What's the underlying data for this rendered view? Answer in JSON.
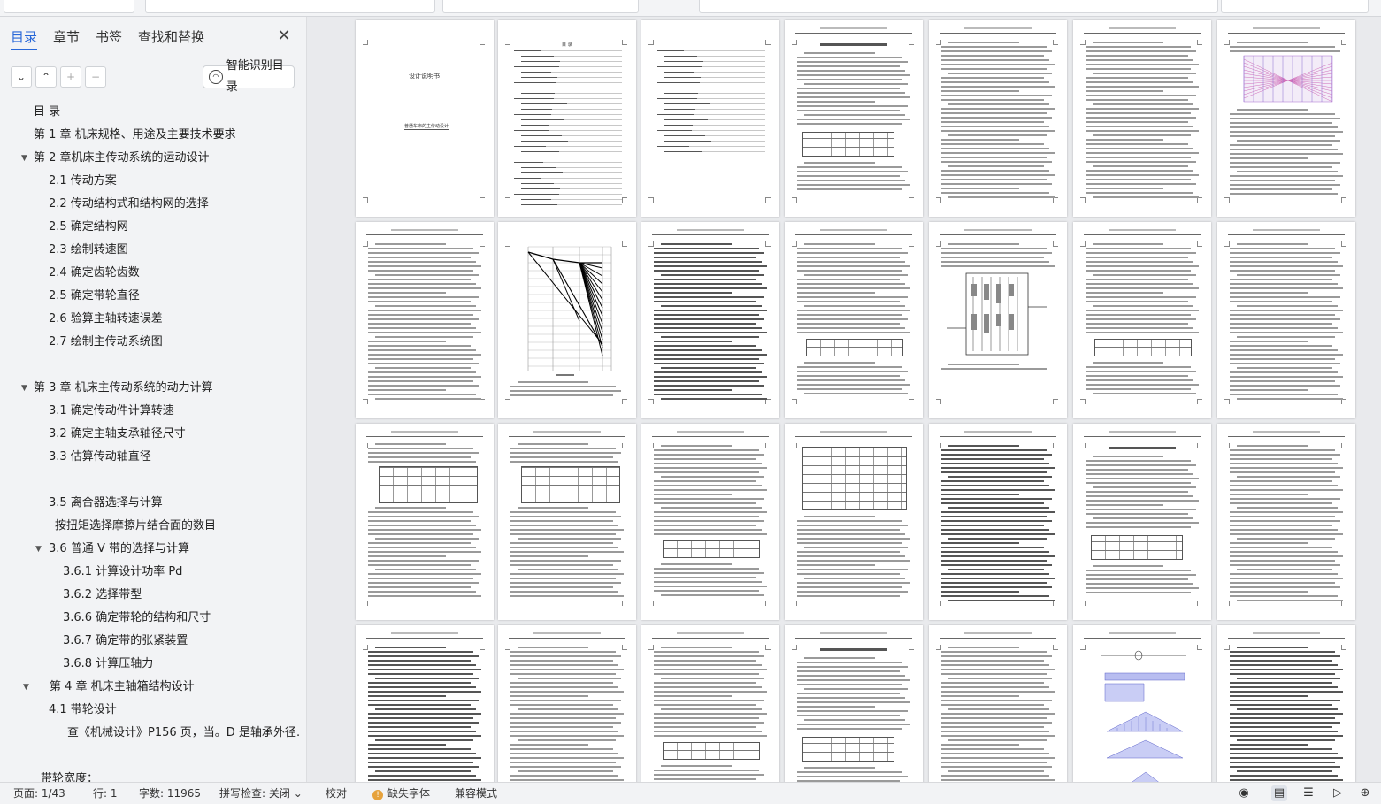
{
  "panel": {
    "tabs": [
      "目录",
      "章节",
      "书签",
      "查找和替换"
    ],
    "close_icon": "close-icon",
    "tools": {
      "collapse": "chevron-down-icon",
      "expand": "chevron-up-icon",
      "add": "plus-icon",
      "remove": "minus-icon"
    },
    "smart_toc_label": "智能识别目录"
  },
  "toc": [
    {
      "text": "目  录",
      "level": 1,
      "arrow": ""
    },
    {
      "text": "第 1 章  机床规格、用途及主要技术要求",
      "level": 1,
      "arrow": ""
    },
    {
      "text": "第 2 章机床主传动系统的运动设计",
      "level": 1,
      "arrow": "▼"
    },
    {
      "text": "2.1  传动方案",
      "level": 2,
      "arrow": ""
    },
    {
      "text": "2.2 传动结构式和结构网的选择",
      "level": 2,
      "arrow": ""
    },
    {
      "text": "2.5 确定结构网",
      "level": 2,
      "arrow": ""
    },
    {
      "text": "2.3 绘制转速图",
      "level": 2,
      "arrow": ""
    },
    {
      "text": "2.4  确定齿轮齿数",
      "level": 2,
      "arrow": ""
    },
    {
      "text": "2.5  确定带轮直径",
      "level": 2,
      "arrow": ""
    },
    {
      "text": "2.6  验算主轴转速误差",
      "level": 2,
      "arrow": ""
    },
    {
      "text": "2.7  绘制主传动系统图",
      "level": 2,
      "arrow": ""
    },
    {
      "text": "",
      "level": 2,
      "arrow": ""
    },
    {
      "text": "第 3 章  机床主传动系统的动力计算",
      "level": 1,
      "arrow": "▼"
    },
    {
      "text": "3.1  确定传动件计算转速",
      "level": 2,
      "arrow": ""
    },
    {
      "text": "3.2  确定主轴支承轴径尺寸",
      "level": 2,
      "arrow": ""
    },
    {
      "text": "3.3  估算传动轴直径",
      "level": 2,
      "arrow": ""
    },
    {
      "text": "",
      "level": 2,
      "arrow": ""
    },
    {
      "text": "3.5 离合器选择与计算",
      "level": 2,
      "arrow": ""
    },
    {
      "text": "按扭矩选择摩擦片结合面的数目",
      "level": 2,
      "arrow": "",
      "indent": 62
    },
    {
      "text": "3.6  普通 V 带的选择与计算",
      "level": 2,
      "arrow": "▼",
      "arrowLeft": 40
    },
    {
      "text": "3.6.1 计算设计功率 Pd",
      "level": 3,
      "arrow": ""
    },
    {
      "text": "3.6.2 选择带型",
      "level": 3,
      "arrow": ""
    },
    {
      "text": "3.6.6 确定带轮的结构和尺寸",
      "level": 3,
      "arrow": ""
    },
    {
      "text": "3.6.7 确定带的张紧装置",
      "level": 3,
      "arrow": ""
    },
    {
      "text": "3.6.8 计算压轴力",
      "level": 3,
      "arrow": ""
    },
    {
      "text": "第 4 章  机床主轴箱结构设计",
      "level": 1,
      "arrow": "▼",
      "indent": 56,
      "arrowLeft": 26
    },
    {
      "text": "4.1  带轮设计",
      "level": 2,
      "arrow": ""
    },
    {
      "text": "查《机械设计》P156 页，当。D 是轴承外径…",
      "level": 3,
      "arrow": "",
      "indent": 76
    },
    {
      "text": "",
      "level": 2,
      "arrow": ""
    },
    {
      "text": "带轮宽度：",
      "level": 1,
      "arrow": "",
      "indent": 46
    }
  ],
  "document": {
    "cover_title": "设计说明书",
    "cover_subtitle": "普通车床的主传动设计",
    "contents_heading": "目  录"
  },
  "status": {
    "page": "页面: 1/43",
    "line": "行: 1",
    "words": "字数: 11965",
    "spell": "拼写检查: 关闭",
    "proof": "校对",
    "missing_font": "缺失字体",
    "compat": "兼容模式"
  },
  "colors": {
    "accent": "#2867d8",
    "warning": "#e6a23c"
  }
}
